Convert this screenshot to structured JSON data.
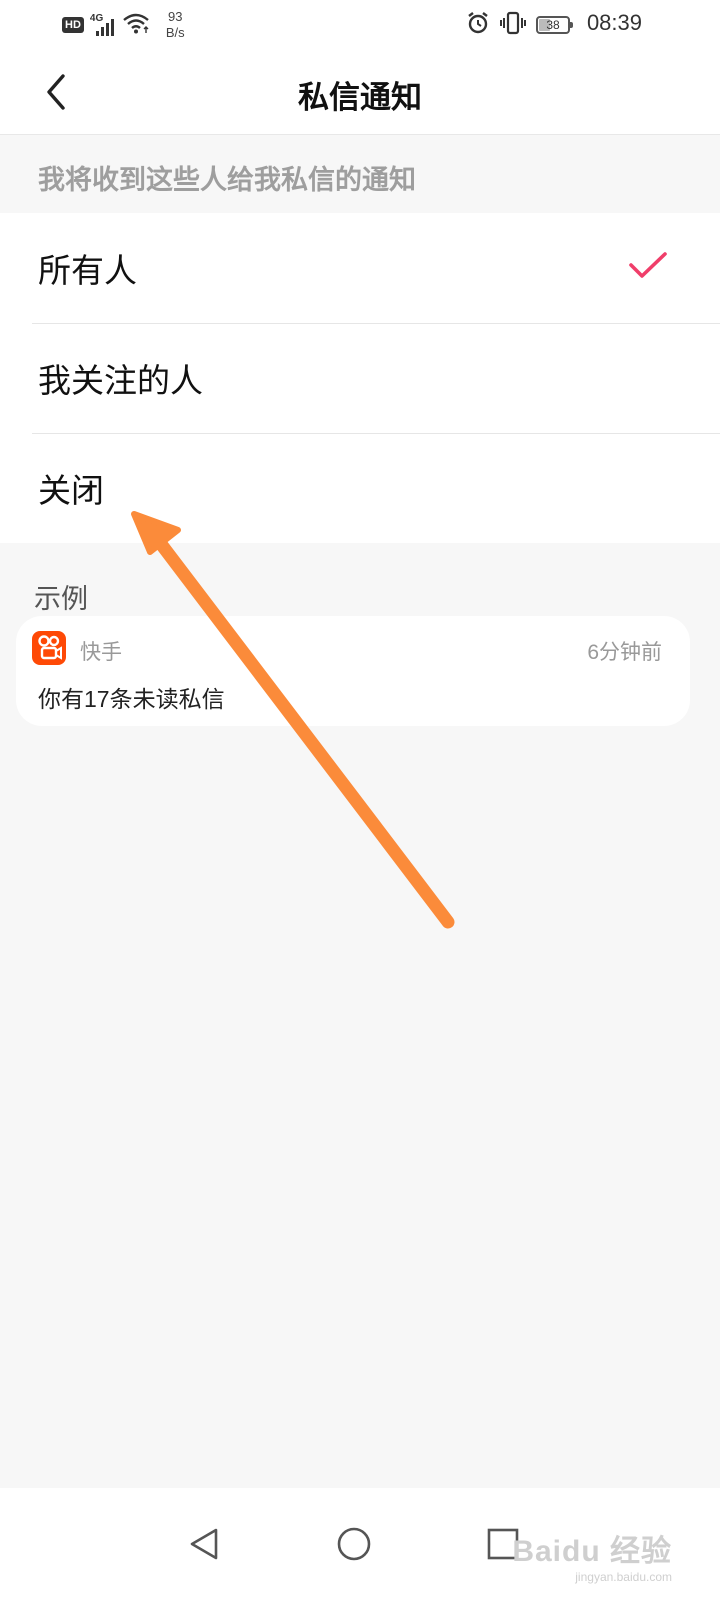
{
  "status_bar": {
    "hd": "HD",
    "network": "4G",
    "speed_value": "93",
    "speed_unit": "B/s",
    "battery": "38",
    "time": "08:39",
    "icons": [
      "hd-icon",
      "signal-icon",
      "wifi-icon",
      "alarm-icon",
      "vibrate-icon",
      "battery-icon"
    ]
  },
  "header": {
    "title": "私信通知",
    "back_icon": "chevron-left-icon"
  },
  "section_hint": "我将收到这些人给我私信的通知",
  "options": [
    {
      "label": "所有人",
      "selected": true
    },
    {
      "label": "我关注的人",
      "selected": false
    },
    {
      "label": "关闭",
      "selected": false
    }
  ],
  "example": {
    "label": "示例",
    "app_name": "快手",
    "time_ago": "6分钟前",
    "message": "你有17条未读私信"
  },
  "watermark": {
    "main": "Baidu 经验",
    "sub": "jingyan.baidu.com"
  },
  "colors": {
    "check": "#f03e6a",
    "arrow": "#fb8b3a",
    "app_icon": "#fe4906",
    "hint_text": "#9e9e9e",
    "background": "#f7f7f7"
  },
  "nav_bar": {
    "icons": [
      "back-triangle-icon",
      "home-circle-icon",
      "recents-square-icon"
    ]
  }
}
